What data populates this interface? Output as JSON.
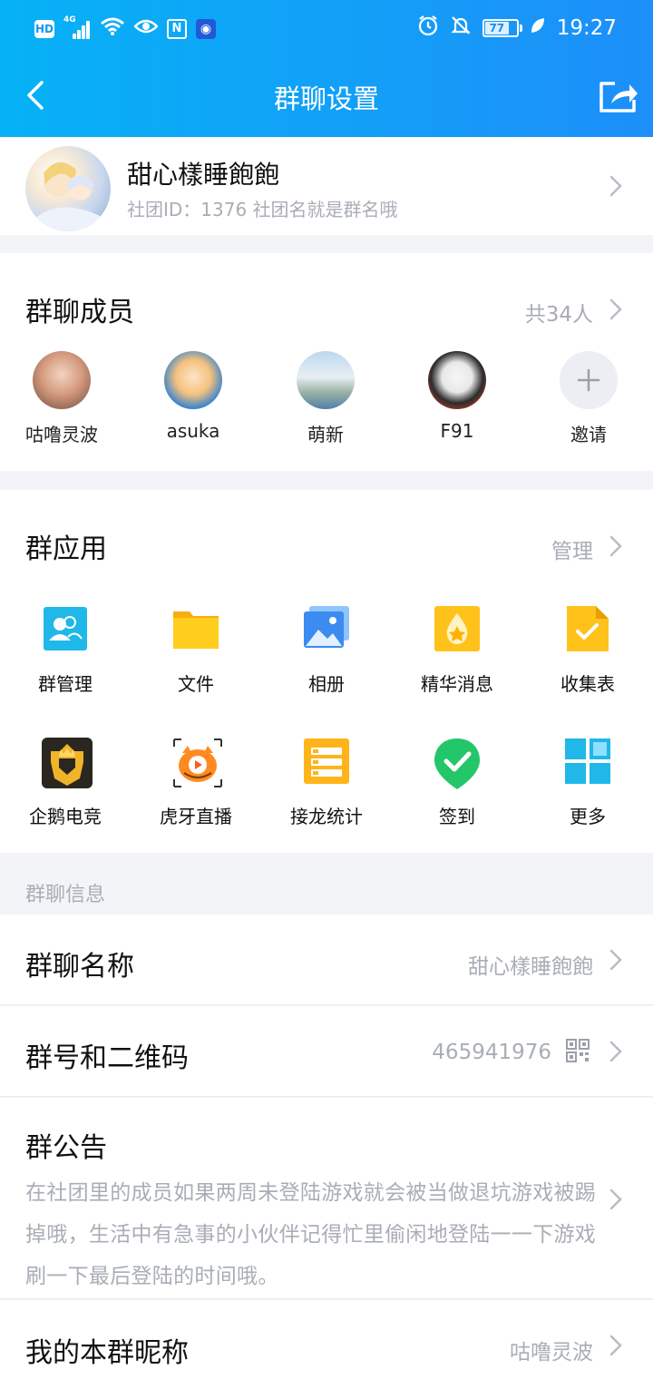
{
  "status_bar": {
    "time": "19:27",
    "battery": "77",
    "network": "4G"
  },
  "nav": {
    "title": "群聊设置",
    "back_icon": "back-chevron-icon",
    "share_icon": "share-icon"
  },
  "group": {
    "name": "甜心樣睡飽飽",
    "subtitle": "社团ID：1376 社团名就是群名哦"
  },
  "members": {
    "title": "群聊成员",
    "count": "共34人",
    "items": [
      {
        "name": "咕噜灵波"
      },
      {
        "name": "asuka"
      },
      {
        "name": "萌新"
      },
      {
        "name": "F91"
      },
      {
        "name": "邀请"
      }
    ]
  },
  "apps": {
    "title": "群应用",
    "manage": "管理",
    "items": [
      {
        "label": "群管理",
        "icon": "group-manage-icon",
        "color": "#1fb8e8"
      },
      {
        "label": "文件",
        "icon": "folder-icon",
        "color": "#ffc21a"
      },
      {
        "label": "相册",
        "icon": "photo-album-icon",
        "color": "#3b8bf0"
      },
      {
        "label": "精华消息",
        "icon": "essence-icon",
        "color": "#ffc21a"
      },
      {
        "label": "收集表",
        "icon": "form-icon",
        "color": "#ffc21a"
      },
      {
        "label": "企鹅电竞",
        "icon": "esports-icon",
        "color": "#2a2a2a"
      },
      {
        "label": "虎牙直播",
        "icon": "huya-icon",
        "color": "#ff8a1f"
      },
      {
        "label": "接龙统计",
        "icon": "solitaire-icon",
        "color": "#ffb41a"
      },
      {
        "label": "签到",
        "icon": "checkin-icon",
        "color": "#23c76a"
      },
      {
        "label": "更多",
        "icon": "more-grid-icon",
        "color": "#1fb8e8"
      }
    ]
  },
  "info": {
    "section_label": "群聊信息",
    "group_name_label": "群聊名称",
    "group_name_value": "甜心樣睡飽飽",
    "group_number_label": "群号和二维码",
    "group_number_value": "465941976",
    "notice_label": "群公告",
    "notice_text": "在社团里的成员如果两周未登陆游戏就会被当做退坑游戏被踢掉哦，生活中有急事的小伙伴记得忙里偷闲地登陆一一下游戏刷一下最后登陆的时间哦。",
    "nickname_label": "我的本群昵称",
    "nickname_value": "咕噜灵波"
  }
}
